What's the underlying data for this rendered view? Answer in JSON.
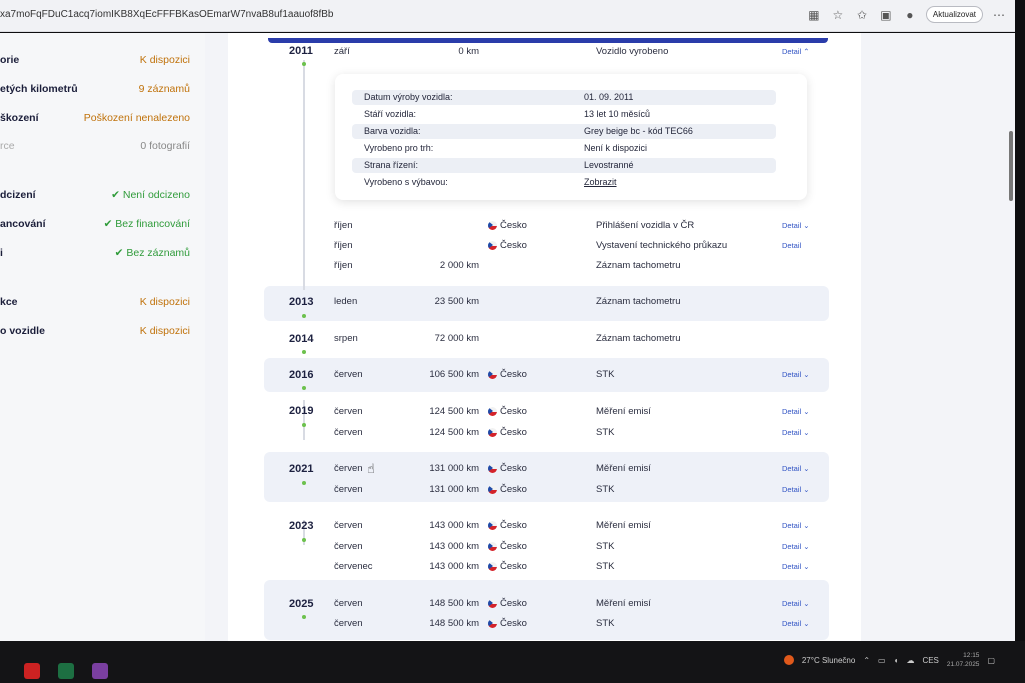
{
  "browser": {
    "url": "xa7moFqFDuC1acq7iomIKB8XqEcFFFBKasOEmarW7nvaB8uf1aauof8fBb",
    "update_label": "Aktualizovat"
  },
  "sidebar": {
    "items": [
      {
        "label": "orie",
        "value": "K dispozici",
        "status": "orange"
      },
      {
        "label": "etých kilometrů",
        "value": "9 záznamů",
        "status": "orange"
      },
      {
        "label": "škození",
        "value": "Poškození nenalezeno",
        "status": "orange"
      },
      {
        "label": "rce",
        "value": "0 fotografií",
        "status": "grey"
      },
      {
        "label": "dcizení",
        "value": "Není odcizeno",
        "status": "green"
      },
      {
        "label": "ancování",
        "value": "Bez financování",
        "status": "green"
      },
      {
        "label": "i",
        "value": "Bez záznamů",
        "status": "green"
      },
      {
        "label": "kce",
        "value": "K dispozici",
        "status": "orange"
      },
      {
        "label": "o vozidle",
        "value": "K dispozici",
        "status": "orange"
      }
    ]
  },
  "detail_popup": {
    "rows": [
      {
        "key": "Datum výroby vozidla:",
        "value": "01. 09. 2011"
      },
      {
        "key": "Stáří vozidla:",
        "value": "13 let 10 měsíců"
      },
      {
        "key": "Barva vozidla:",
        "value": "Grey beige bc - kód TEC66"
      },
      {
        "key": "Vyrobeno pro trh:",
        "value": "Není k dispozici"
      },
      {
        "key": "Strana řízení:",
        "value": "Levostranné"
      },
      {
        "key": "Vyrobeno s výbavou:",
        "value": "Zobrazit"
      }
    ]
  },
  "timeline": {
    "years": [
      "2011",
      "2013",
      "2014",
      "2016",
      "2019",
      "2021",
      "2023",
      "2025"
    ],
    "rows": [
      {
        "month": "září",
        "km": "0 km",
        "country": "",
        "event": "Vozidlo vyrobeno",
        "detail": "Detail ⌃"
      },
      {
        "month": "říjen",
        "km": "",
        "country": "Česko",
        "event": "Přihlášení vozidla v ČR",
        "detail": "Detail ⌄"
      },
      {
        "month": "říjen",
        "km": "",
        "country": "Česko",
        "event": "Vystavení technického průkazu",
        "detail": "Detail"
      },
      {
        "month": "říjen",
        "km": "2 000 km",
        "country": "",
        "event": "Záznam tachometru",
        "detail": ""
      },
      {
        "month": "leden",
        "km": "23 500 km",
        "country": "",
        "event": "Záznam tachometru",
        "detail": ""
      },
      {
        "month": "srpen",
        "km": "72 000 km",
        "country": "",
        "event": "Záznam tachometru",
        "detail": ""
      },
      {
        "month": "červen",
        "km": "106 500 km",
        "country": "Česko",
        "event": "STK",
        "detail": "Detail ⌄"
      },
      {
        "month": "červen",
        "km": "124 500 km",
        "country": "Česko",
        "event": "Měření emisí",
        "detail": "Detail ⌄"
      },
      {
        "month": "červen",
        "km": "124 500 km",
        "country": "Česko",
        "event": "STK",
        "detail": "Detail ⌄"
      },
      {
        "month": "červen",
        "km": "131 000 km",
        "country": "Česko",
        "event": "Měření emisí",
        "detail": "Detail ⌄"
      },
      {
        "month": "červen",
        "km": "131 000 km",
        "country": "Česko",
        "event": "STK",
        "detail": "Detail ⌄"
      },
      {
        "month": "červen",
        "km": "143 000 km",
        "country": "Česko",
        "event": "Měření emisí",
        "detail": "Detail ⌄"
      },
      {
        "month": "červen",
        "km": "143 000 km",
        "country": "Česko",
        "event": "STK",
        "detail": "Detail ⌄"
      },
      {
        "month": "červenec",
        "km": "143 000 km",
        "country": "Česko",
        "event": "STK",
        "detail": "Detail ⌄"
      },
      {
        "month": "červen",
        "km": "148 500 km",
        "country": "Česko",
        "event": "Měření emisí",
        "detail": "Detail ⌄"
      },
      {
        "month": "červen",
        "km": "148 500 km",
        "country": "Česko",
        "event": "STK",
        "detail": "Detail ⌄"
      }
    ]
  },
  "taskbar": {
    "weather": "27°C  Slunečno",
    "lang": "CES",
    "time": "12:15",
    "date": "21.07.2025"
  }
}
